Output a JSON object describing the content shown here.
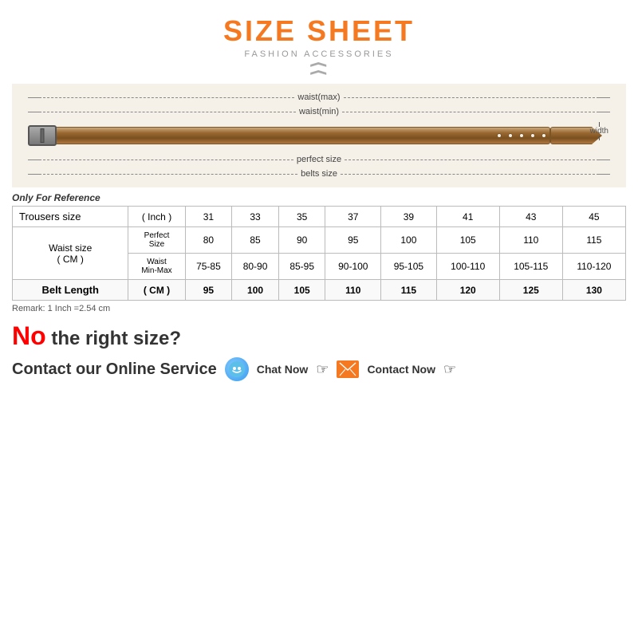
{
  "title": {
    "main": "SIZE SHEET",
    "sub": "FASHION ACCESSORIES"
  },
  "diagram": {
    "labels": {
      "waist_max": "waist(max)",
      "waist_min": "waist(min)",
      "perfect_size": "perfect size",
      "belts_size": "belts size",
      "width": "width"
    }
  },
  "reference_note": "Only For Reference",
  "table": {
    "headers": {
      "trousers": "Trousers size",
      "inch": "( Inch )",
      "sizes": [
        "31",
        "33",
        "35",
        "37",
        "39",
        "41",
        "43",
        "45"
      ]
    },
    "waist_label": "Waist size\n( CM )",
    "rows": {
      "perfect_size_label": "Perfect Size",
      "perfect_values": [
        "80",
        "85",
        "90",
        "95",
        "100",
        "105",
        "110",
        "115"
      ],
      "waist_min_max_label": "Waist Min-Max",
      "waist_values": [
        "75-85",
        "80-90",
        "85-95",
        "90-100",
        "95-105",
        "100-110",
        "105-115",
        "110-120"
      ],
      "belt_length_label": "Belt Length",
      "belt_cm": "( CM )",
      "belt_values": [
        "95",
        "100",
        "105",
        "110",
        "115",
        "120",
        "125",
        "130"
      ]
    }
  },
  "remark": "Remark: 1 Inch =2.54 cm",
  "no_size": {
    "no_text": "No",
    "right_size_text": " the right size?",
    "contact_label": "Contact our Online Service",
    "chat_now": "Chat Now",
    "contact_now": "Contact Now"
  }
}
